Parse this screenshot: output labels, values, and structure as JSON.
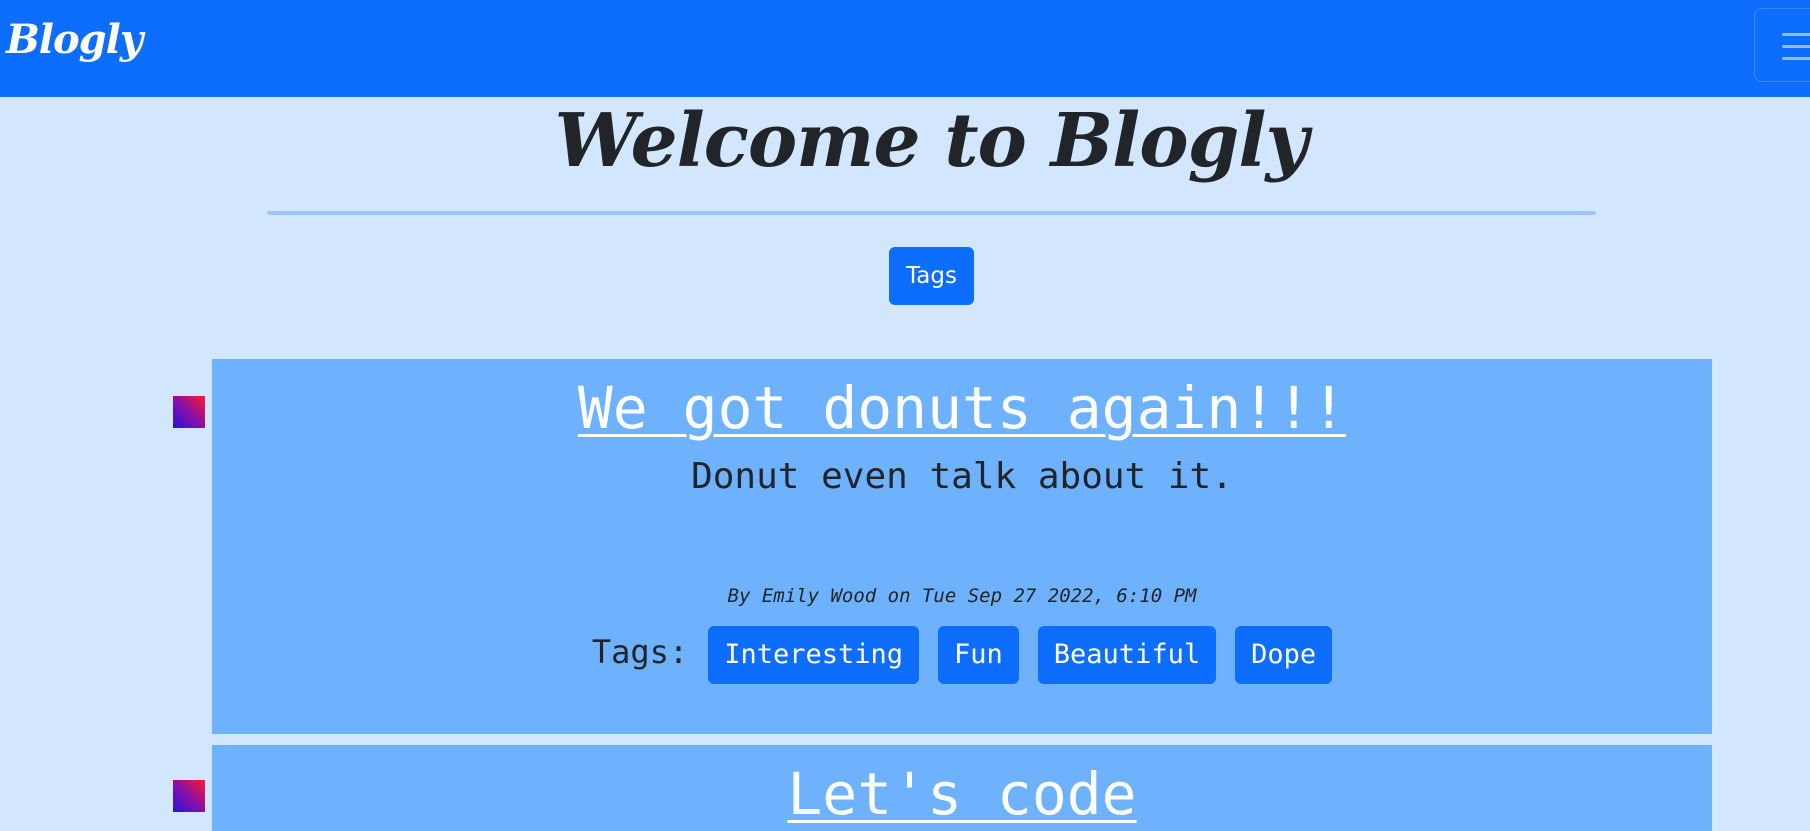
{
  "navbar": {
    "brand": "Blogly",
    "menu_icon": "hamburger-menu-icon"
  },
  "header": {
    "title": "Welcome to Blogly",
    "tags_button_label": "Tags"
  },
  "posts": [
    {
      "title": "We got donuts again!!!",
      "body": "Donut even talk about it.",
      "meta": "By Emily Wood on Tue Sep 27 2022, 6:10 PM",
      "tags_label": "Tags:",
      "tags": [
        "Interesting",
        "Fun",
        "Beautiful",
        "Dope"
      ]
    },
    {
      "title": "Let's code"
    }
  ],
  "colors": {
    "primary": "#0d6efd",
    "page_background": "#d2e7fd",
    "card_background": "#6eb2fe",
    "divider": "#9ec5fe"
  }
}
